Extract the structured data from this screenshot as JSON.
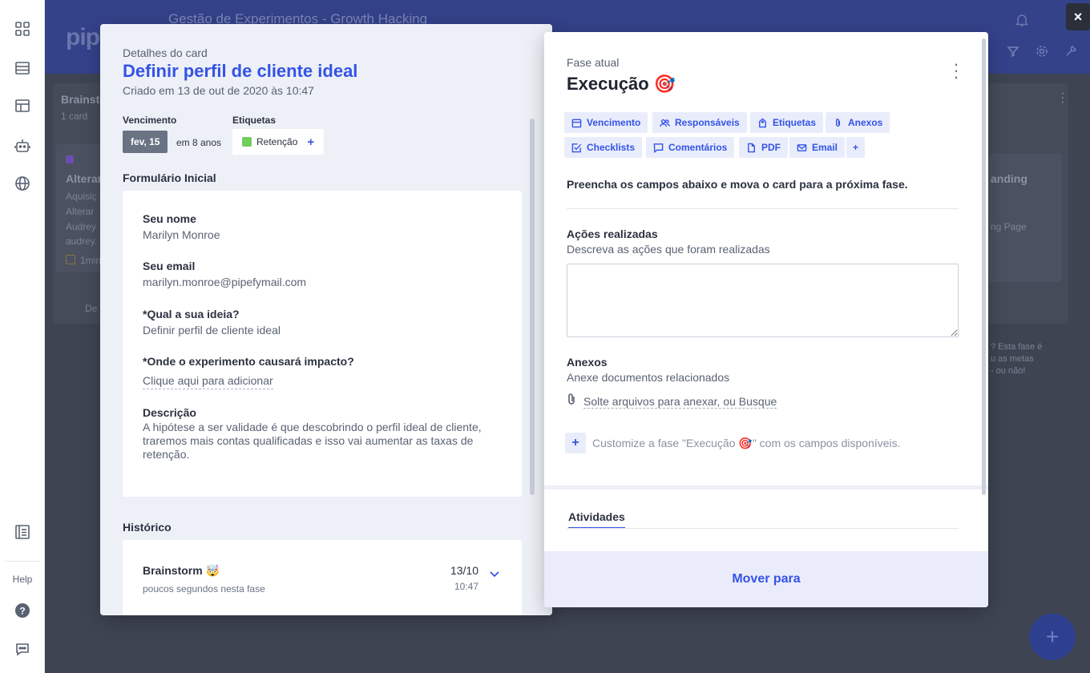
{
  "board": {
    "title": "Gestão de Experimentos - Growth Hacking",
    "logo": "pip",
    "col1_title": "Brainst",
    "col1_count": "1 card",
    "card_title": "Alterar",
    "card_line1": "Aquisiç",
    "card_line2": "Alterar",
    "card_line3": "Audrey",
    "card_line4": "audrey.",
    "card_meta": "1min",
    "col1_footer": "De",
    "col3_title": "anding",
    "col3_line": "ng Page",
    "col3_note1": "? Esta fase é",
    "col3_note2": "u as metas",
    "col3_note3": "- ou não!",
    "fab": "+"
  },
  "nav": {
    "help_label": "Help"
  },
  "close_label": "×",
  "card": {
    "subtitle": "Detalhes do card",
    "title": "Definir perfil de cliente ideal",
    "created": "Criado em 13 de out de 2020 às 10:47",
    "due_label": "Vencimento",
    "due_date": "fev, 15",
    "due_relative": "em 8 anos",
    "tags_label": "Etiquetas",
    "tag": "Retenção",
    "tag_add": "+",
    "tag_color": "#6fcf5c"
  },
  "form": {
    "title": "Formulário Inicial",
    "fields": [
      {
        "label": "Seu nome",
        "value": "Marilyn Monroe"
      },
      {
        "label": "Seu email",
        "value": "marilyn.monroe@pipefymail.com"
      },
      {
        "label": "*Qual a sua ideia?",
        "value": "Definir perfil de cliente ideal"
      },
      {
        "label": "*Onde o experimento causará impacto?",
        "value": "Clique aqui para adicionar"
      },
      {
        "label": "Descrição",
        "value": "A hipótese a ser validade é que descobrindo o perfil ideal de cliente, traremos mais contas qualificadas e isso vai aumentar as taxas de retenção."
      }
    ]
  },
  "history": {
    "title": "Histórico",
    "items": [
      {
        "phase": "Brainstorm 🤯",
        "duration": "poucos segundos nesta fase",
        "date": "13/10",
        "time": "10:47"
      }
    ]
  },
  "phase": {
    "subtitle": "Fase atual",
    "title": "Execução 🎯",
    "chips": [
      "Vencimento",
      "Responsáveis",
      "Etiquetas",
      "Anexos",
      "Checklists",
      "Comentários",
      "PDF",
      "Email",
      "+"
    ],
    "instruction": "Preencha os campos abaixo e mova o card para a próxima fase.",
    "field1_label": "Ações realizadas",
    "field1_help": "Descreva as ações que foram realizadas",
    "field2_label": "Anexos",
    "field2_help": "Anexe documentos relacionados",
    "attach_link": "Solte arquivos para anexar, ou Busque",
    "customize": "Customize a fase \"Execução 🎯\" com os campos disponíveis.",
    "customize_plus": "+",
    "activities_tab": "Atividades",
    "move_button": "Mover para"
  },
  "colors": {
    "accent": "#3453e6",
    "header": "#34428a",
    "overlay": "#3a4150"
  }
}
